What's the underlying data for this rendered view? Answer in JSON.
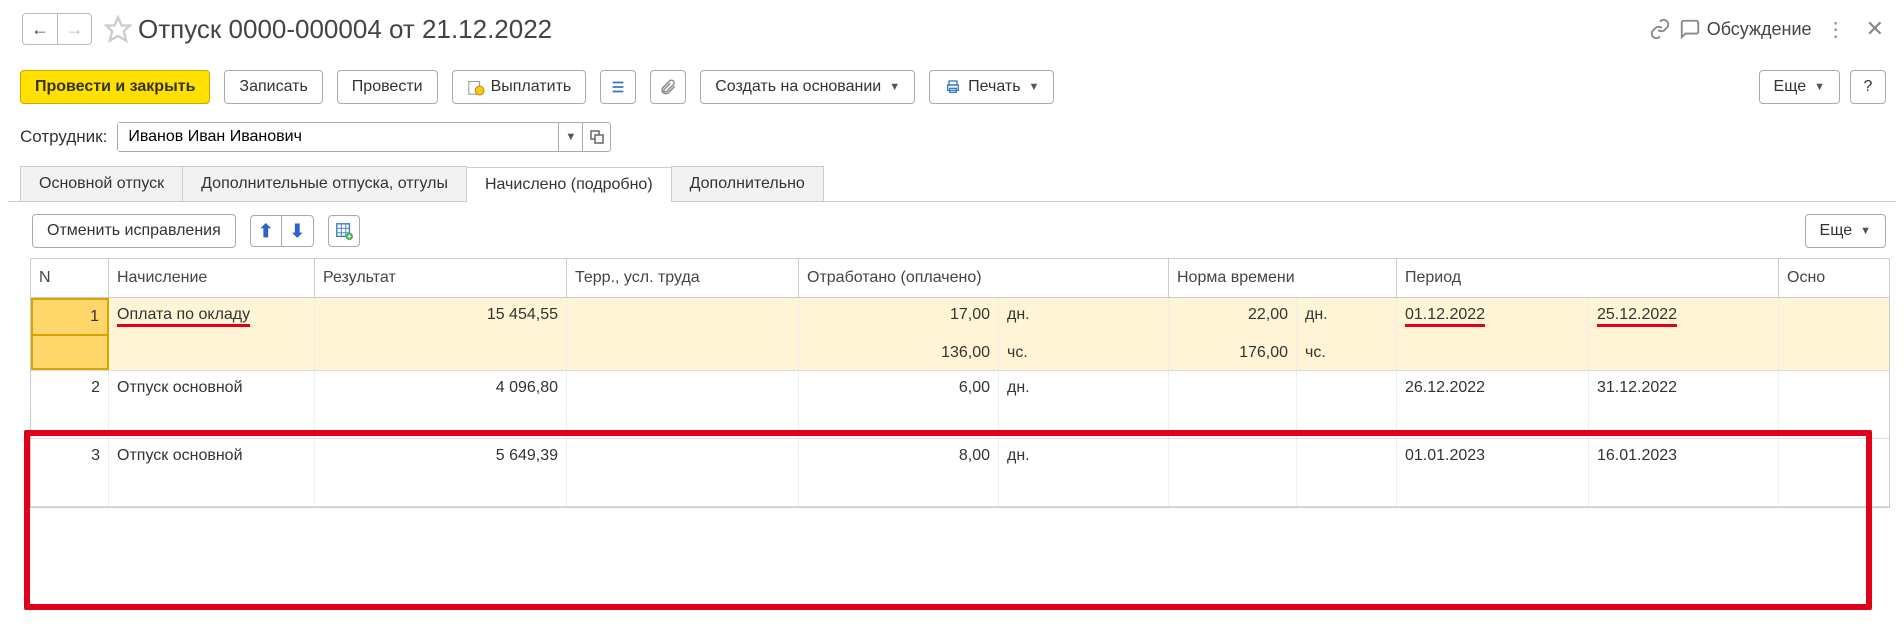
{
  "header": {
    "title": "Отпуск 0000-000004 от 21.12.2022",
    "discuss_label": "Обсуждение"
  },
  "toolbar": {
    "post_close": "Провести и закрыть",
    "record": "Записать",
    "post": "Провести",
    "payout": "Выплатить",
    "create_based": "Создать на основании",
    "print": "Печать",
    "more": "Еще",
    "help": "?"
  },
  "employee": {
    "label": "Сотрудник:",
    "value": "Иванов Иван Иванович"
  },
  "tabs": {
    "t0": "Основной отпуск",
    "t1": "Дополнительные отпуска, отгулы",
    "t2": "Начислено (подробно)",
    "t3": "Дополнительно"
  },
  "subtoolbar": {
    "cancel_edits": "Отменить исправления",
    "more": "Еще"
  },
  "grid": {
    "headers": {
      "n": "N",
      "accrual": "Начисление",
      "result": "Результат",
      "territory": "Терр., усл. труда",
      "worked": "Отработано (оплачено)",
      "norm": "Норма времени",
      "period": "Период",
      "basis": "Осно"
    },
    "rows": [
      {
        "n": "1",
        "accrual": "Оплата по окладу",
        "result": "15 454,55",
        "worked_days": "17,00",
        "worked_days_u": "дн.",
        "worked_hours": "136,00",
        "worked_hours_u": "чс.",
        "norm_days": "22,00",
        "norm_days_u": "дн.",
        "norm_hours": "176,00",
        "norm_hours_u": "чс.",
        "period_from": "01.12.2022",
        "period_to": "25.12.2022",
        "selected": true,
        "underline": true
      },
      {
        "n": "2",
        "accrual": "Отпуск основной",
        "result": "4 096,80",
        "worked_days": "6,00",
        "worked_days_u": "дн.",
        "period_from": "26.12.2022",
        "period_to": "31.12.2022"
      },
      {
        "n": "3",
        "accrual": "Отпуск основной",
        "result": "5 649,39",
        "worked_days": "8,00",
        "worked_days_u": "дн.",
        "period_from": "01.01.2023",
        "period_to": "16.01.2023"
      }
    ]
  }
}
